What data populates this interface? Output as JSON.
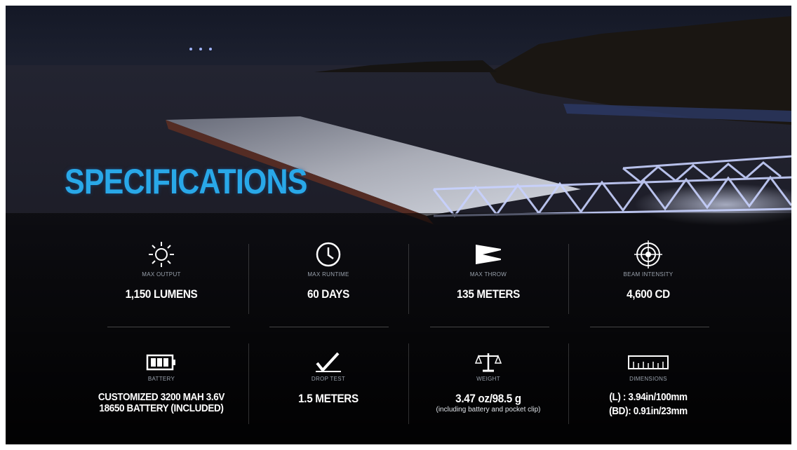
{
  "title": "SPECIFICATIONS",
  "specs_top": [
    {
      "icon": "sun-icon",
      "label": "MAX OUTPUT",
      "value": "1,150 LUMENS"
    },
    {
      "icon": "clock-icon",
      "label": "MAX RUNTIME",
      "value": "60 DAYS"
    },
    {
      "icon": "beam-icon",
      "label": "MAX THROW",
      "value": "135 METERS"
    },
    {
      "icon": "target-icon",
      "label": "BEAM INTENSITY",
      "value": "4,600 CD"
    }
  ],
  "specs_bottom": [
    {
      "icon": "battery-icon",
      "label": "BATTERY",
      "value_line1": "CUSTOMIZED 3200 MAH 3.6V",
      "value_line2": "18650 BATTERY (INCLUDED)"
    },
    {
      "icon": "drop-test-icon",
      "label": "DROP TEST",
      "value": "1.5 METERS"
    },
    {
      "icon": "scale-icon",
      "label": "WEIGHT",
      "value": "3.47 oz/98.5 g",
      "note": "(including battery and pocket clip)"
    },
    {
      "icon": "ruler-icon",
      "label": "DIMENSIONS",
      "value_line1": "(L) : 3.94in/100mm",
      "value_line2": "(BD): 0.91in/23mm"
    }
  ],
  "colors": {
    "title": "#29a8e8",
    "background": "#05060a",
    "text": "#ffffff"
  }
}
